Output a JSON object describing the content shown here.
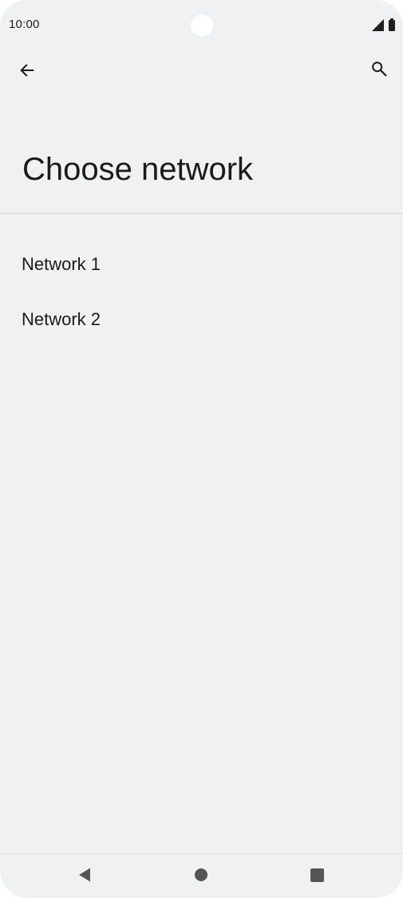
{
  "status_bar": {
    "time": "10:00",
    "icons": [
      "signal-icon",
      "battery-icon"
    ]
  },
  "app_bar": {
    "back_icon": "arrow-back-icon",
    "search_icon": "search-icon"
  },
  "page": {
    "title": "Choose network"
  },
  "networks": [
    {
      "label": "Network 1"
    },
    {
      "label": "Network 2"
    }
  ],
  "nav_bar": {
    "icons": [
      "nav-back-icon",
      "nav-home-icon",
      "nav-recents-icon"
    ]
  },
  "colors": {
    "background": "#f0f1f3",
    "text": "#1b1b1b",
    "divider": "#e1e2e4",
    "nav_icon": "#555555"
  }
}
